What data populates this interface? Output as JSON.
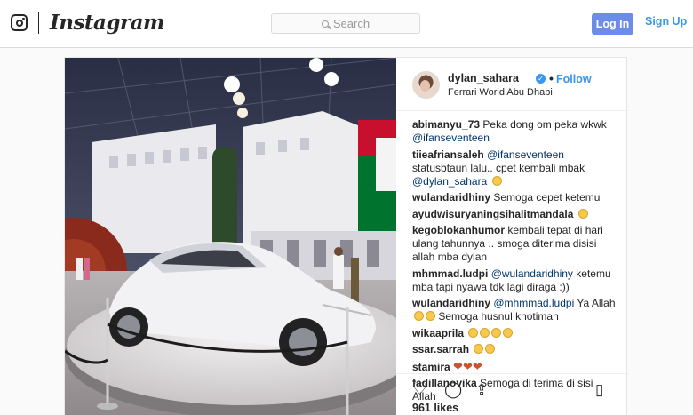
{
  "nav": {
    "wordmark": "Instagram",
    "search_placeholder": "Search",
    "login_label": "Log In",
    "signup_label": "Sign Up",
    "icons": [
      "instagram-logo-icon",
      "search-icon"
    ]
  },
  "post": {
    "username": "dylan_sahara",
    "separator": "•",
    "follow_label": "Follow",
    "location": "Ferrari World Abu Dhabi",
    "likes": "961 likes",
    "action_icons": [
      "heart-icon",
      "comment-icon",
      "share-icon",
      "bookmark-icon"
    ],
    "comments": [
      {
        "user": "abimanyu_73",
        "text": "Peka dong om peka wkwk",
        "mention": "@ifanseventeen",
        "emoji": ""
      },
      {
        "user": "tiieafriansaleh",
        "mention": "@ifanseventeen",
        "text": "statusbtaun lalu.. cpet kembali mbak",
        "mention2": "@dylan_sahara",
        "emoji": "crying-face"
      },
      {
        "user": "wulandaridhiny",
        "text": "Semoga cepet ketemu",
        "emoji": ""
      },
      {
        "user": "ayudwisuryaningsihalitmandala",
        "text": "",
        "emoji": "crying-face"
      },
      {
        "user": "kegoblokanhumor",
        "text": "kembali tepat di hari ulang tahunnya .. smoga diterima disisi allah mba dylan",
        "emoji": ""
      },
      {
        "user": "mhmmad.ludpi",
        "mention": "@wulandaridhiny",
        "text": "ketemu mba tapi nyawa tdk lagi diraga :))",
        "emoji": ""
      },
      {
        "user": "wulandaridhiny",
        "mention": "@mhmmad.ludpi",
        "text": "Ya Allah",
        "text2": "Semoga husnul khotimah",
        "emoji": "crying-face x2"
      },
      {
        "user": "wikaaprila",
        "text": "",
        "emoji": "crying-face x4"
      },
      {
        "user": "ssar.sarrah",
        "text": "",
        "emoji": "crying-face x2"
      },
      {
        "user": "stamira",
        "text": "",
        "emoji": "heart x3"
      },
      {
        "user": "fadillanovika",
        "text": "Semoga di terima di sisi Allah",
        "emoji": ""
      }
    ]
  },
  "colors": {
    "link": "#3897f0",
    "login_bg": "#6b8ce8",
    "border": "#dbdbdb",
    "car": "#f2f2f2",
    "flag_red": "#c8102e",
    "flag_green": "#00732f"
  }
}
